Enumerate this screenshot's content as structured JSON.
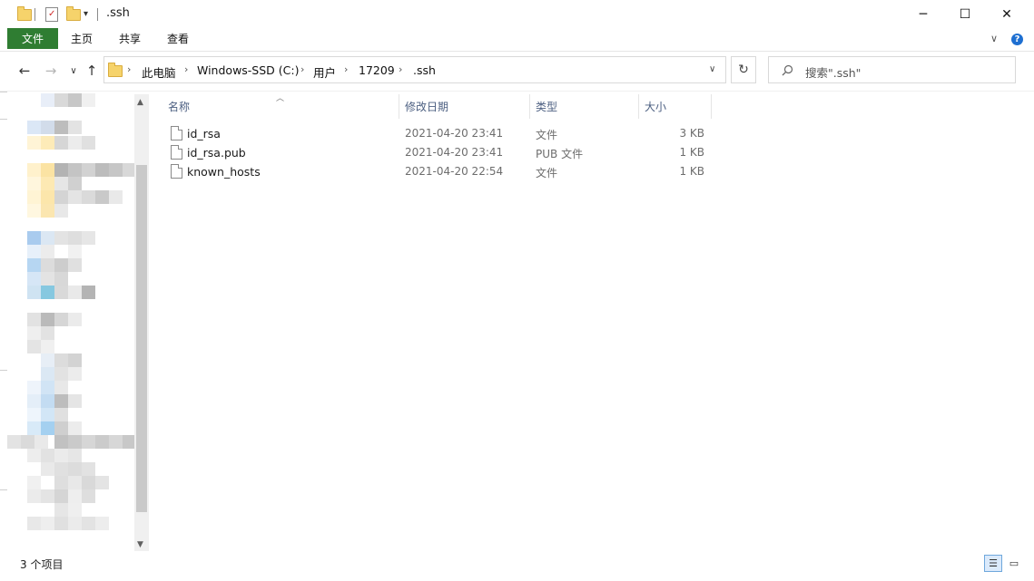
{
  "window": {
    "title": ".ssh",
    "controls": {
      "minimize": "─",
      "maximize": "☐",
      "close": "✕"
    }
  },
  "ribbon": {
    "tabs": [
      "文件",
      "主页",
      "共享",
      "查看"
    ],
    "help": "?",
    "expand": "∨"
  },
  "nav": {
    "back": "←",
    "forward": "→",
    "recent": "∨",
    "up": "↑",
    "breadcrumbs": [
      "此电脑",
      "Windows-SSD (C:)",
      "用户",
      "17209",
      ".ssh"
    ],
    "dropdown": "∨",
    "refresh": "↻",
    "search_placeholder": "搜索\".ssh\""
  },
  "columns": [
    "名称",
    "修改日期",
    "类型",
    "大小"
  ],
  "files": [
    {
      "name": "id_rsa",
      "modified": "2021-04-20 23:41",
      "type": "文件",
      "size": "3 KB"
    },
    {
      "name": "id_rsa.pub",
      "modified": "2021-04-20 23:41",
      "type": "PUB 文件",
      "size": "1 KB"
    },
    {
      "name": "known_hosts",
      "modified": "2021-04-20 22:54",
      "type": "文件",
      "size": "1 KB"
    }
  ],
  "status": {
    "item_count": "3 个项目"
  },
  "colors": {
    "file_tab": "#2f7d32",
    "help": "#1e6fd1",
    "header_text": "#4d6082"
  }
}
